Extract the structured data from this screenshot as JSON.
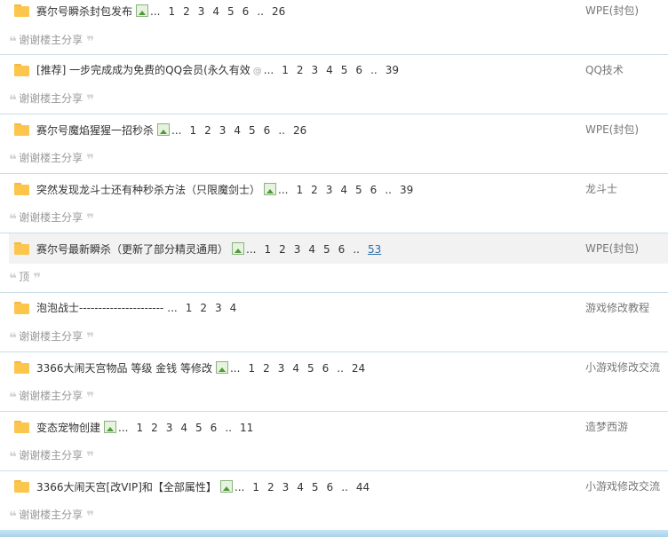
{
  "threads": [
    {
      "title": "赛尔号瞬杀封包发布",
      "attach": "image",
      "pages": [
        "1",
        "2",
        "3",
        "4",
        "5",
        "6",
        ".."
      ],
      "last": "26",
      "forum": "WPE(封包)",
      "reply": "谢谢楼主分享"
    },
    {
      "title": "[推荐] 一步完成成为免费的QQ会员(永久有效",
      "attach": "clip",
      "pages": [
        "1",
        "2",
        "3",
        "4",
        "5",
        "6",
        ".."
      ],
      "last": "39",
      "forum": "QQ技术",
      "reply": "谢谢楼主分享"
    },
    {
      "title": "赛尔号魔焰猩猩一招秒杀",
      "attach": "image",
      "pages": [
        "1",
        "2",
        "3",
        "4",
        "5",
        "6",
        ".."
      ],
      "last": "26",
      "forum": "WPE(封包)",
      "reply": "谢谢楼主分享"
    },
    {
      "title": "突然发现龙斗士还有种秒杀方法（只限魔剑士）",
      "attach": "image",
      "pages": [
        "1",
        "2",
        "3",
        "4",
        "5",
        "6",
        ".."
      ],
      "last": "39",
      "forum": "龙斗士",
      "reply": "谢谢楼主分享"
    },
    {
      "title": "赛尔号最新瞬杀（更新了部分精灵通用）",
      "attach": "image",
      "pages": [
        "1",
        "2",
        "3",
        "4",
        "5",
        "6",
        ".."
      ],
      "last": "53",
      "forum": "WPE(封包)",
      "reply": "顶"
    },
    {
      "title": "泡泡战士----------------------",
      "attach": "none",
      "pages": [
        "1",
        "2",
        "3"
      ],
      "last": "4",
      "forum": "游戏修改教程",
      "reply": "谢谢楼主分享"
    },
    {
      "title": "3366大闹天宫物品 等级 金钱 等修改",
      "attach": "image",
      "pages": [
        "1",
        "2",
        "3",
        "4",
        "5",
        "6",
        ".."
      ],
      "last": "24",
      "forum": "小游戏修改交流",
      "reply": "谢谢楼主分享"
    },
    {
      "title": "变态宠物创建",
      "attach": "image",
      "pages": [
        "1",
        "2",
        "3",
        "4",
        "5",
        "6",
        ".."
      ],
      "last": "11",
      "forum": "造梦西游",
      "reply": "谢谢楼主分享"
    },
    {
      "title": "3366大闹天宫[改VIP]和【全部属性】",
      "attach": "image",
      "pages": [
        "1",
        "2",
        "3",
        "4",
        "5",
        "6",
        ".."
      ],
      "last": "44",
      "forum": "小游戏修改交流",
      "reply": "谢谢楼主分享"
    }
  ],
  "ellipsis": "...",
  "quote_open": "❛❛",
  "quote_close": "❜❜",
  "colors": {
    "folder": "#fcc64d",
    "divider": "#c9dde8",
    "link": "#2b6eab",
    "hover_row": "#f2f2f2"
  },
  "icons": {
    "folder": "folder-icon",
    "image_attachment": "image-attachment-icon",
    "clip_attachment": "paperclip-icon"
  }
}
